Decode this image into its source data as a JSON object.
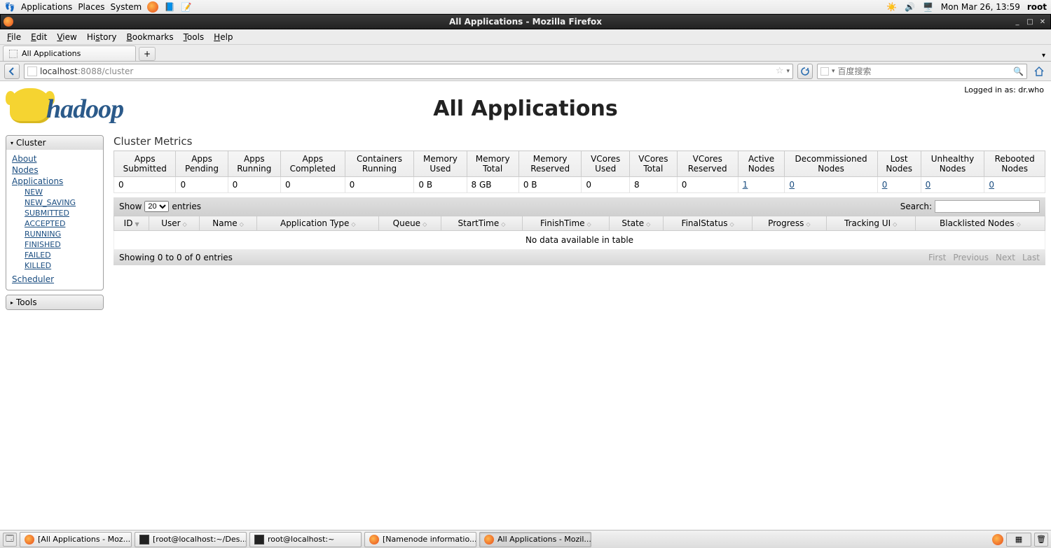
{
  "gnome": {
    "menus": [
      "Applications",
      "Places",
      "System"
    ],
    "datetime": "Mon Mar 26, 13:59",
    "user": "root"
  },
  "window": {
    "title": "All Applications - Mozilla Firefox"
  },
  "firefox": {
    "menu": [
      "File",
      "Edit",
      "View",
      "History",
      "Bookmarks",
      "Tools",
      "Help"
    ],
    "tab_title": "All Applications",
    "url_host": "localhost",
    "url_rest": ":8088/cluster",
    "search_placeholder": "百度搜索"
  },
  "page": {
    "logged_in": "Logged in as: dr.who",
    "logo_text": "hadoop",
    "title": "All Applications",
    "sidebar": {
      "cluster_label": "Cluster",
      "tools_label": "Tools",
      "links": {
        "about": "About",
        "nodes": "Nodes",
        "applications": "Applications",
        "scheduler": "Scheduler"
      },
      "app_states": [
        "NEW",
        "NEW_SAVING",
        "SUBMITTED",
        "ACCEPTED",
        "RUNNING",
        "FINISHED",
        "FAILED",
        "KILLED"
      ]
    },
    "metrics": {
      "title": "Cluster Metrics",
      "headers": [
        "Apps Submitted",
        "Apps Pending",
        "Apps Running",
        "Apps Completed",
        "Containers Running",
        "Memory Used",
        "Memory Total",
        "Memory Reserved",
        "VCores Used",
        "VCores Total",
        "VCores Reserved",
        "Active Nodes",
        "Decommissioned Nodes",
        "Lost Nodes",
        "Unhealthy Nodes",
        "Rebooted Nodes"
      ],
      "values": [
        "0",
        "0",
        "0",
        "0",
        "0",
        "0 B",
        "8 GB",
        "0 B",
        "0",
        "8",
        "0",
        "1",
        "0",
        "0",
        "0",
        "0"
      ],
      "link_indices": [
        11,
        12,
        13,
        14,
        15
      ]
    },
    "datatable": {
      "show_label_pre": "Show",
      "show_value": "20",
      "show_label_post": "entries",
      "search_label": "Search:",
      "columns": [
        "ID",
        "User",
        "Name",
        "Application Type",
        "Queue",
        "StartTime",
        "FinishTime",
        "State",
        "FinalStatus",
        "Progress",
        "Tracking UI",
        "Blacklisted Nodes"
      ],
      "empty": "No data available in table",
      "footer_info": "Showing 0 to 0 of 0 entries",
      "pager": [
        "First",
        "Previous",
        "Next",
        "Last"
      ]
    }
  },
  "taskbar": {
    "items": [
      {
        "label": "[All Applications - Moz...",
        "icon": "firefox",
        "active": false
      },
      {
        "label": "[root@localhost:~/Des...",
        "icon": "terminal",
        "active": false
      },
      {
        "label": "root@localhost:~",
        "icon": "terminal",
        "active": false
      },
      {
        "label": "[Namenode informatio...",
        "icon": "firefox",
        "active": false
      },
      {
        "label": "All Applications - Mozil...",
        "icon": "firefox",
        "active": true
      }
    ]
  }
}
